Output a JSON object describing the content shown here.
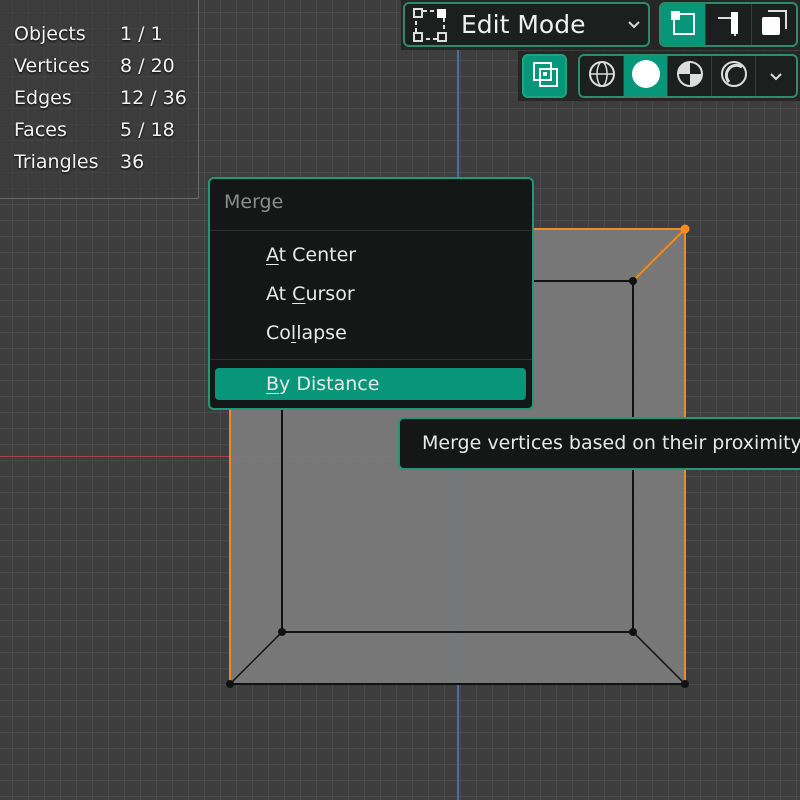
{
  "stats": [
    {
      "label": "Objects",
      "value": "1 / 1"
    },
    {
      "label": "Vertices",
      "value": "8 / 20"
    },
    {
      "label": "Edges",
      "value": "12 / 36"
    },
    {
      "label": "Faces",
      "value": "5 / 18"
    },
    {
      "label": "Triangles",
      "value": "36"
    }
  ],
  "header": {
    "mode_label": "Edit Mode",
    "mode_icon": "edit-mode-icon",
    "select_modes": [
      "vertex-select-icon",
      "edge-select-icon",
      "face-select-icon"
    ],
    "active_select_mode": "vertex"
  },
  "shading": {
    "overlay_icon": "xray-toggle-icon",
    "modes": [
      "wireframe-icon",
      "solid-icon",
      "material-preview-icon",
      "rendered-icon"
    ],
    "active_mode": "solid"
  },
  "merge_menu": {
    "title": "Merge",
    "items": [
      {
        "pre": "",
        "key": "A",
        "post": "t Center"
      },
      {
        "pre": "At ",
        "key": "C",
        "post": "ursor"
      },
      {
        "pre": "Co",
        "key": "l",
        "post": "lapse"
      },
      {
        "pre": "",
        "key": "B",
        "post": "y Distance"
      }
    ],
    "highlighted": "By Distance"
  },
  "tooltip": {
    "text": "Merge vertices based on their proximity"
  },
  "colors": {
    "accent": "#07967a",
    "selection_orange": "#f08c1f",
    "x_axis": "#a84147",
    "y_axis": "#3f6fb5"
  }
}
